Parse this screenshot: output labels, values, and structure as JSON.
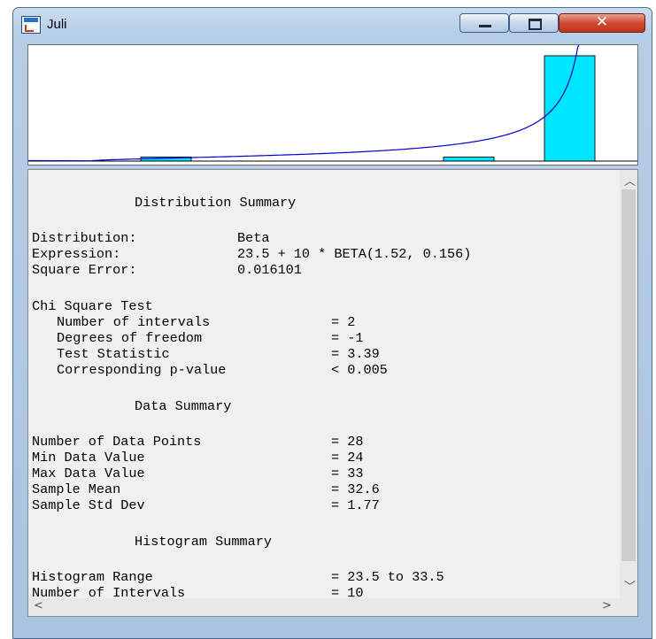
{
  "window": {
    "title": "Juli"
  },
  "histogram": {
    "bins": [
      0,
      1,
      0,
      0,
      0,
      0,
      0,
      1,
      0,
      26
    ],
    "range": [
      23.5,
      33.5
    ],
    "bar_color": "#00e5ff",
    "curve_color": "#0000cc"
  },
  "summary": {
    "heading": "Distribution Summary",
    "distribution_label": "Distribution:",
    "distribution_value": "Beta",
    "expression_label": "Expression:",
    "expression_value": "23.5 + 10 * BETA(1.52, 0.156)",
    "square_error_label": "Square Error:",
    "square_error_value": "0.016101"
  },
  "chi_square": {
    "heading": "Chi Square Test",
    "intervals_label": "Number of intervals",
    "intervals_value": "= 2",
    "dof_label": "Degrees of freedom",
    "dof_value": "= -1",
    "statistic_label": "Test Statistic",
    "statistic_value": "= 3.39",
    "pvalue_label": "Corresponding p-value",
    "pvalue_value": "< 0.005"
  },
  "data_summary": {
    "heading": "Data Summary",
    "points_label": "Number of Data Points",
    "points_value": "= 28",
    "min_label": "Min Data Value",
    "min_value": "= 24",
    "max_label": "Max Data Value",
    "max_value": "= 33",
    "mean_label": "Sample Mean",
    "mean_value": "= 32.6",
    "std_label": "Sample Std Dev",
    "std_value": "= 1.77"
  },
  "histogram_summary": {
    "heading": "Histogram Summary",
    "range_label": "Histogram Range",
    "range_value": "= 23.5 to 33.5",
    "intervals_label": "Number of Intervals",
    "intervals_value": "= 10"
  }
}
